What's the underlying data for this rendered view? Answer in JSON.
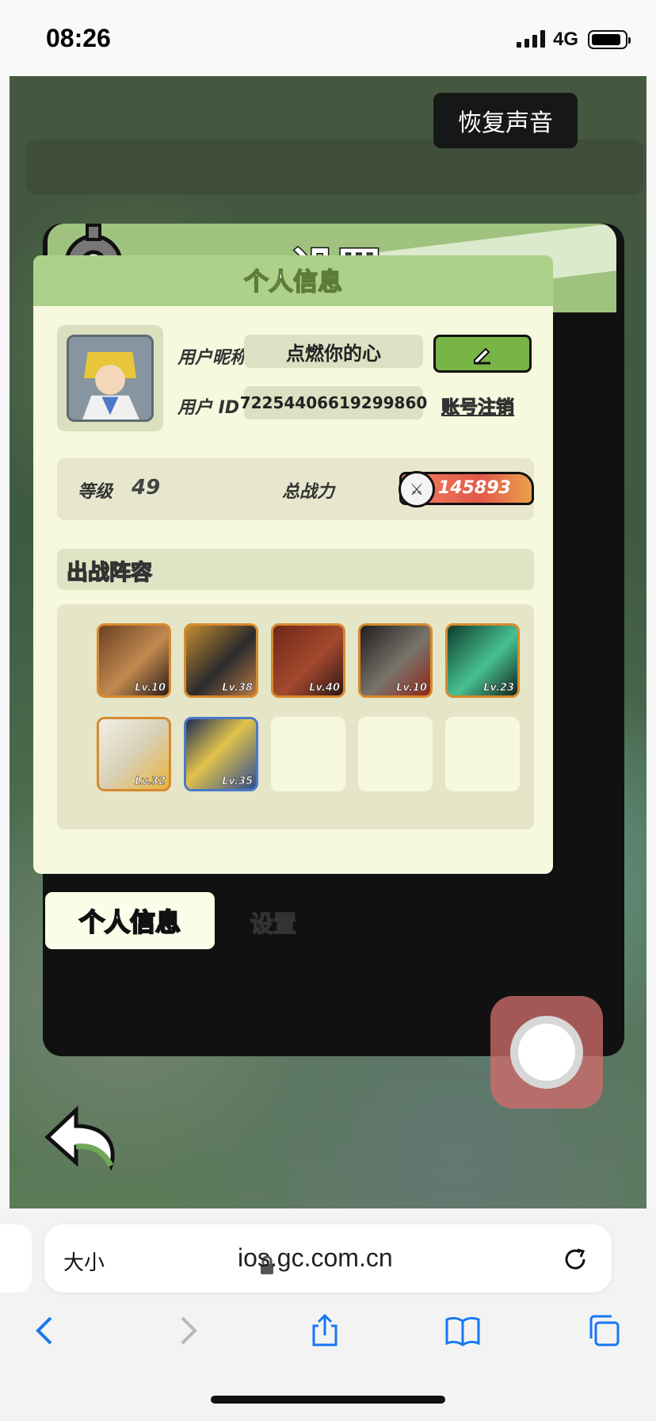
{
  "status": {
    "time": "08:26",
    "network": "4G"
  },
  "game": {
    "sound_label": "恢复声音",
    "settings_title": "设置",
    "section_personal": "个人信息",
    "nickname_label": "用户昵称",
    "nickname_value": "点燃你的心",
    "id_label": "用户 ID",
    "id_value": "72254406619299860",
    "deregister_label": "账号注销",
    "level_label": "等级",
    "level_value": "49",
    "power_label": "总战力",
    "power_value": "145893",
    "lineup_title": "出战阵容",
    "heroes": [
      {
        "level": "Lv.10"
      },
      {
        "level": "Lv.38"
      },
      {
        "level": "Lv.40"
      },
      {
        "level": "Lv.10"
      },
      {
        "level": "Lv.23"
      },
      {
        "level": "Lv.32"
      },
      {
        "level": "Lv.35"
      }
    ],
    "tabs": {
      "personal": "个人信息",
      "settings": "设置"
    }
  },
  "safari": {
    "text_size": "大小",
    "url": "ios.gc.com.cn"
  }
}
